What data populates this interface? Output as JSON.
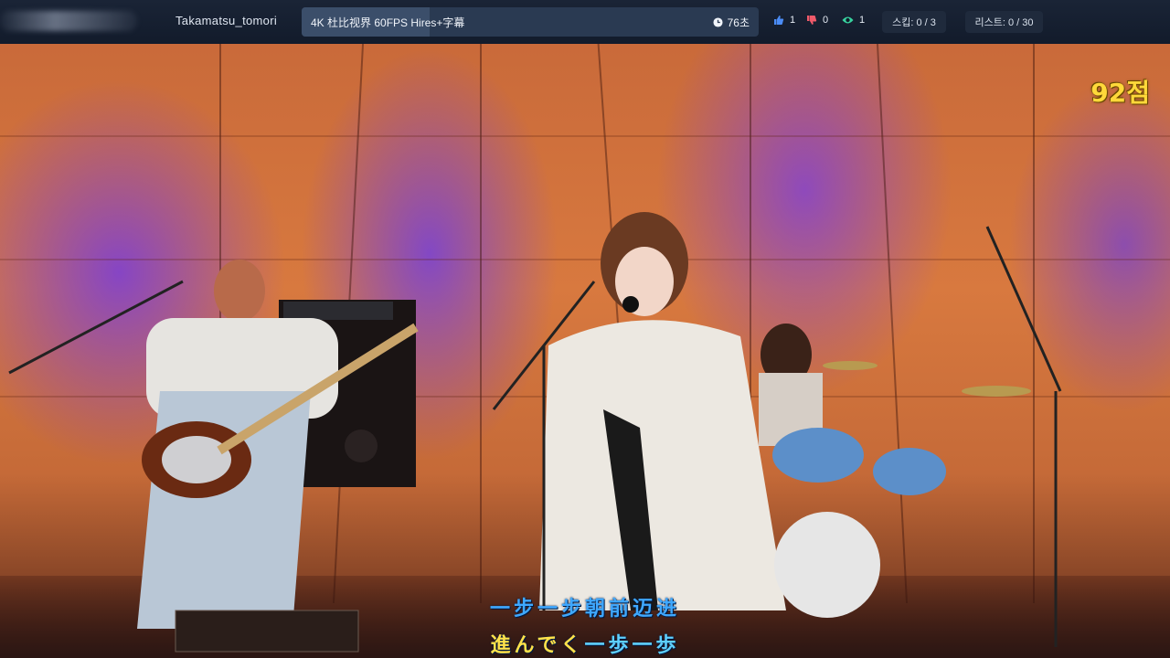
{
  "header": {
    "username": "Takamatsu_tomori",
    "video_title": "4K 杜比视界 60FPS Hires+字幕",
    "progress": 0.28,
    "time": "76초",
    "likes": "1",
    "dislikes": "0",
    "views": "1",
    "skip": "스킵: 0 / 3",
    "list": "리스트: 0 / 30"
  },
  "video": {
    "score": "92점",
    "lyric_line_1": "一步一步朝前迈进",
    "lyric_line_2_hl": "進んでく",
    "lyric_line_2_rest": "一歩一歩"
  },
  "colors": {
    "accent_blue": "#3b82f6",
    "like_icon": "#4b8cf5",
    "dislike_icon": "#f05a6a",
    "view_icon": "#38d39f",
    "score": "#ffd83a"
  }
}
